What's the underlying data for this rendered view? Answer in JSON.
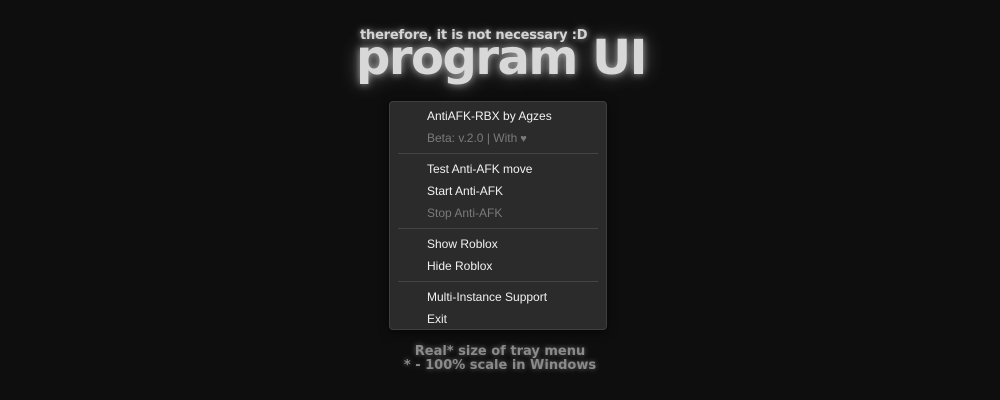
{
  "header": {
    "subtitle": "therefore, it is not necessary :D",
    "title": "program UI"
  },
  "menu": {
    "app_name": "AntiAFK-RBX by Agzes",
    "version": "Beta: v.2.0 | With",
    "version_icon": "heart-icon",
    "items": {
      "test_move": "Test Anti-AFK move",
      "start": "Start Anti-AFK",
      "stop": "Stop Anti-AFK",
      "show_roblox": "Show Roblox",
      "hide_roblox": "Hide Roblox",
      "multi_instance": "Multi-Instance Support",
      "exit": "Exit"
    }
  },
  "footer": {
    "line1": "Real* size of tray menu",
    "line2": "* - 100% scale in Windows"
  },
  "colors": {
    "background": "#0e0e0e",
    "menu_bg": "#2b2b2b",
    "text": "#f0f0f0",
    "disabled_text": "#7a7a7a"
  }
}
